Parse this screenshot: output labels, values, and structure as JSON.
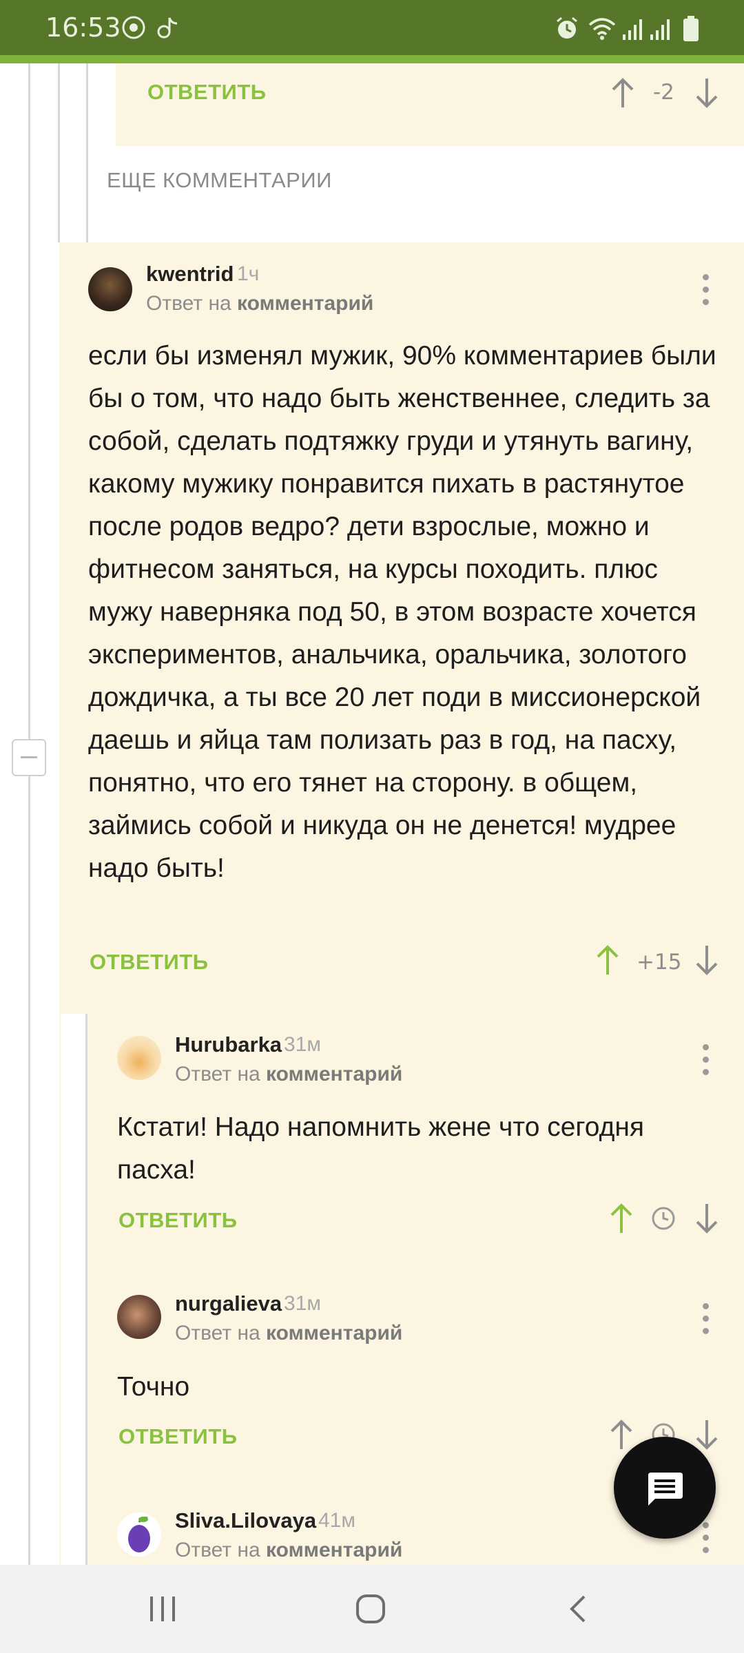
{
  "status_bar": {
    "time": "16:53"
  },
  "top_comment_footer": {
    "reply_label": "ОТВЕТИТЬ",
    "score": "-2"
  },
  "more_comments_label": "ЕЩЕ КОММЕНТАРИИ",
  "comments": [
    {
      "username": "kwentrid",
      "ago": "1ч",
      "reply_prefix": "Ответ на",
      "reply_target": "комментарий",
      "text": "если бы изменял мужик, 90% комментариев были бы о том, что надо быть женственнее, следить за собой, сделать подтяжку груди и утянуть вагину, какому мужику понравится пихать в растянутое после родов ведро? дети взрослые, можно и фитнесом заняться, на курсы походить. плюс мужу наверняка под 50, в этом возрасте хочется экспериментов, анальчика, оральчика, золотого дождичка, а ты все 20 лет поди в миссионерской даешь и яйца там полизать раз в год, на пасху, понятно, что его тянет на сторону. в общем, займись собой и никуда он не денется! мудрее надо быть!",
      "reply_label": "ОТВЕТИТЬ",
      "score": "+15"
    },
    {
      "username": "Hurubarka",
      "ago": "31м",
      "reply_prefix": "Ответ на",
      "reply_target": "комментарий",
      "text": "Кстати! Надо напомнить жене что сегодня пасха!",
      "reply_label": "ОТВЕТИТЬ"
    },
    {
      "username": "nurgalieva",
      "ago": "31м",
      "reply_prefix": "Ответ на",
      "reply_target": "комментарий",
      "text": "Точно",
      "reply_label": "ОТВЕТИТЬ"
    },
    {
      "username": "Sliva.Lilovaya",
      "ago": "41м",
      "reply_prefix": "Ответ на",
      "reply_target": "комментарий"
    }
  ],
  "colors": {
    "accent_green": "#8ac23f",
    "status_bar": "#56762a",
    "comment_bg": "#fcf5e2"
  },
  "icons": [
    "shield-icon",
    "tiktok-icon",
    "alarm-icon",
    "wifi-icon",
    "signal-icon",
    "battery-icon",
    "arrow-up-icon",
    "arrow-down-icon",
    "clock-icon",
    "more-vertical-icon",
    "chat-icon",
    "recents-icon",
    "home-icon",
    "back-icon"
  ]
}
